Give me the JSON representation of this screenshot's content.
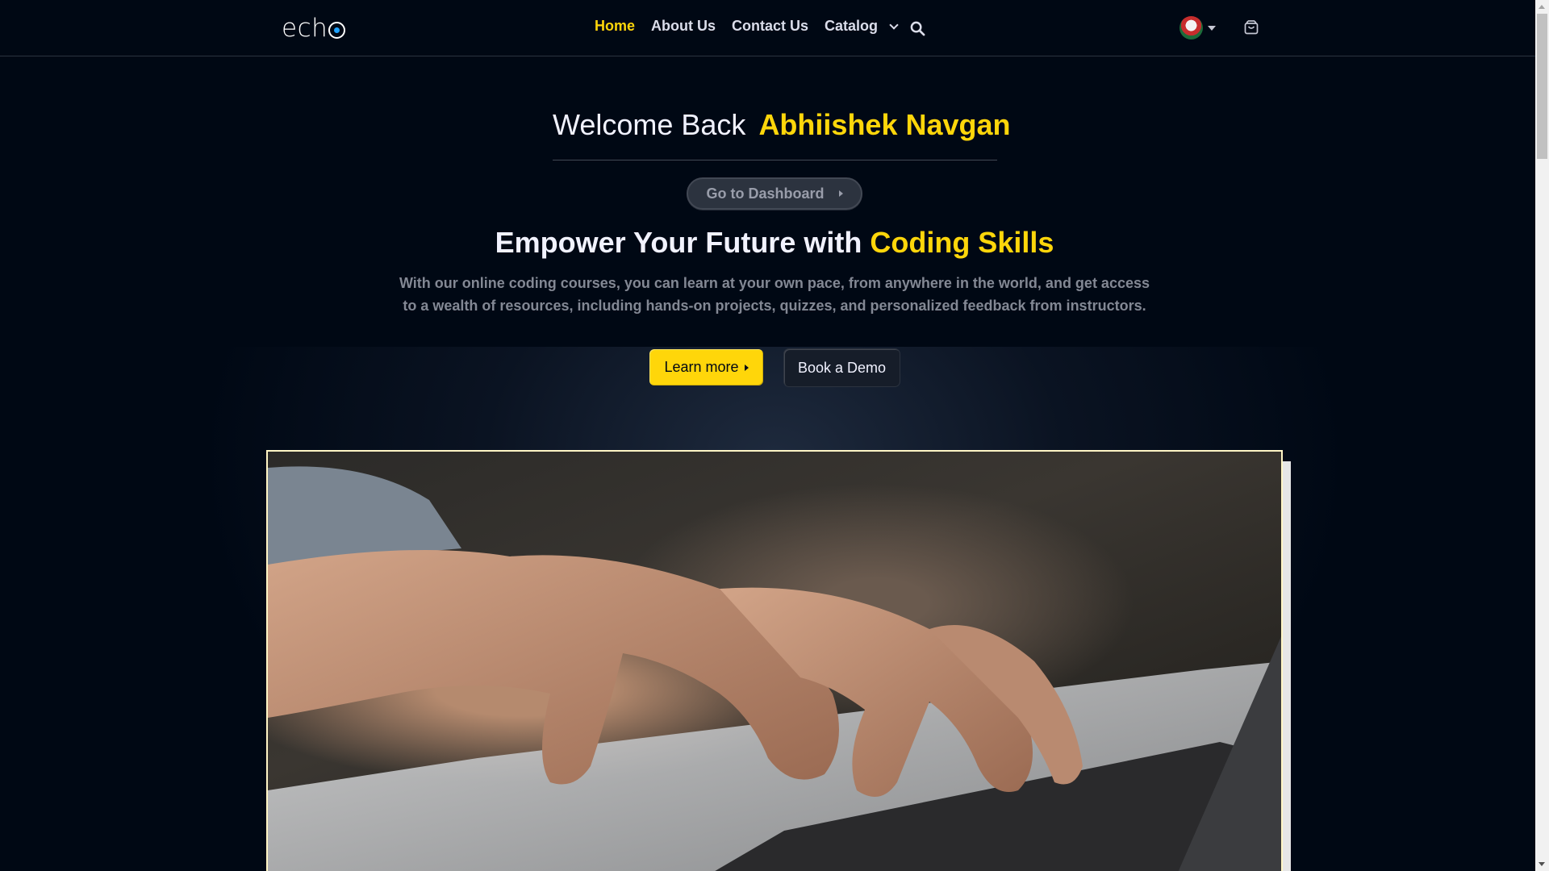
{
  "brand": {
    "logo_text": "ech",
    "logo_icon": "echo-logo-o"
  },
  "nav": {
    "items": [
      {
        "label": "Home",
        "active": true
      },
      {
        "label": "About Us",
        "active": false
      },
      {
        "label": "Contact Us",
        "active": false
      },
      {
        "label": "Catalog",
        "active": false
      }
    ],
    "search_icon": "search-icon",
    "cart_icon": "shopping-bag-icon",
    "avatar_icon": "user-avatar"
  },
  "hero": {
    "welcome_prefix": "Welcome Back",
    "welcome_name": "Abhiishek Navgan",
    "dashboard_button": "Go to Dashboard",
    "headline_prefix": "Empower Your Future with",
    "headline_highlight": "Coding Skills",
    "description": "With our online coding courses, you can learn at your own pace, from anywhere in the world, and get access to a wealth of resources, including hands-on projects, quizzes, and personalized feedback from instructors.",
    "learn_more": "Learn more",
    "book_demo": "Book a Demo"
  },
  "colors": {
    "background": "#000814",
    "accent": "#ffd60a",
    "text": "#f1f2ff",
    "muted": "#838894"
  }
}
